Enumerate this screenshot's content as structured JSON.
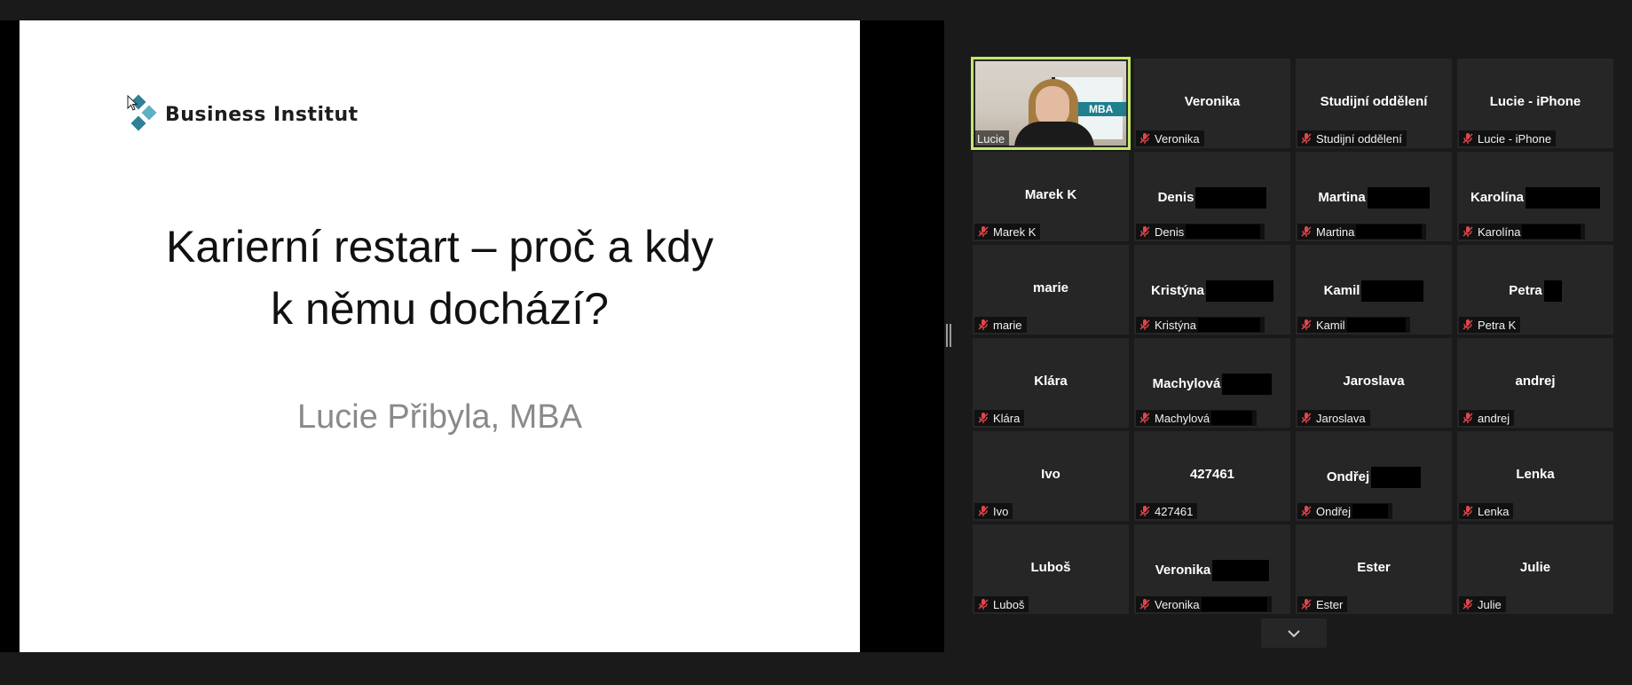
{
  "slide": {
    "logo_text": "Business Institut",
    "title_line1": "Karierní restart – proč a kdy",
    "title_line2": "k němu dochází?",
    "subtitle": "Lucie Přibyla, MBA"
  },
  "colors": {
    "background": "#1a1a1a",
    "tile_background": "#262626",
    "active_speaker_border": "#c4e86a",
    "muted_icon": "#e0474c",
    "logo_teal_light": "#5fb0c4",
    "logo_teal_dark": "#2f7f95"
  },
  "participants": [
    {
      "name": "",
      "label": "Lucie",
      "video": true,
      "active": true,
      "muted": false
    },
    {
      "name": "Veronika",
      "label": "Veronika",
      "muted": true
    },
    {
      "name": "Studijní oddělení",
      "label": "Studijní oddělení",
      "muted": true
    },
    {
      "name": "Lucie - iPhone",
      "label": "Lucie - iPhone",
      "muted": true
    },
    {
      "name": "Marek K",
      "label": "Marek K",
      "muted": true
    },
    {
      "name": "Denis",
      "label": "Denis",
      "muted": true
    },
    {
      "name": "Martina",
      "label": "Martina",
      "muted": true
    },
    {
      "name": "Karolína",
      "label": "Karolína",
      "muted": true
    },
    {
      "name": "marie",
      "label": "marie",
      "muted": true
    },
    {
      "name": "Kristýna",
      "label": "Kristýna",
      "muted": true
    },
    {
      "name": "Kamil",
      "label": "Kamil",
      "muted": true
    },
    {
      "name": "Petra",
      "label": "Petra K",
      "muted": true
    },
    {
      "name": "Klára",
      "label": "Klára",
      "muted": true
    },
    {
      "name": "Machylová",
      "label": "Machylová",
      "muted": true
    },
    {
      "name": "Jaroslava",
      "label": "Jaroslava",
      "muted": true
    },
    {
      "name": "andrej",
      "label": "andrej",
      "muted": true
    },
    {
      "name": "Ivo",
      "label": "Ivo",
      "muted": true
    },
    {
      "name": "427461",
      "label": "427461",
      "muted": true
    },
    {
      "name": "Ondřej",
      "label": "Ondřej",
      "muted": true
    },
    {
      "name": "Lenka",
      "label": "Lenka",
      "muted": true
    },
    {
      "name": "Luboš",
      "label": "Luboš",
      "muted": true
    },
    {
      "name": "Veronika",
      "label": "Veronika",
      "muted": true
    },
    {
      "name": "Ester",
      "label": "Ester",
      "muted": true
    },
    {
      "name": "Julie",
      "label": "Julie",
      "muted": true
    }
  ],
  "video_tile": {
    "banner_text": "MBA"
  },
  "icons": {
    "muted": "microphone-muted-icon",
    "scroll": "chevron-down-icon",
    "cursor": "mouse-pointer-icon"
  }
}
